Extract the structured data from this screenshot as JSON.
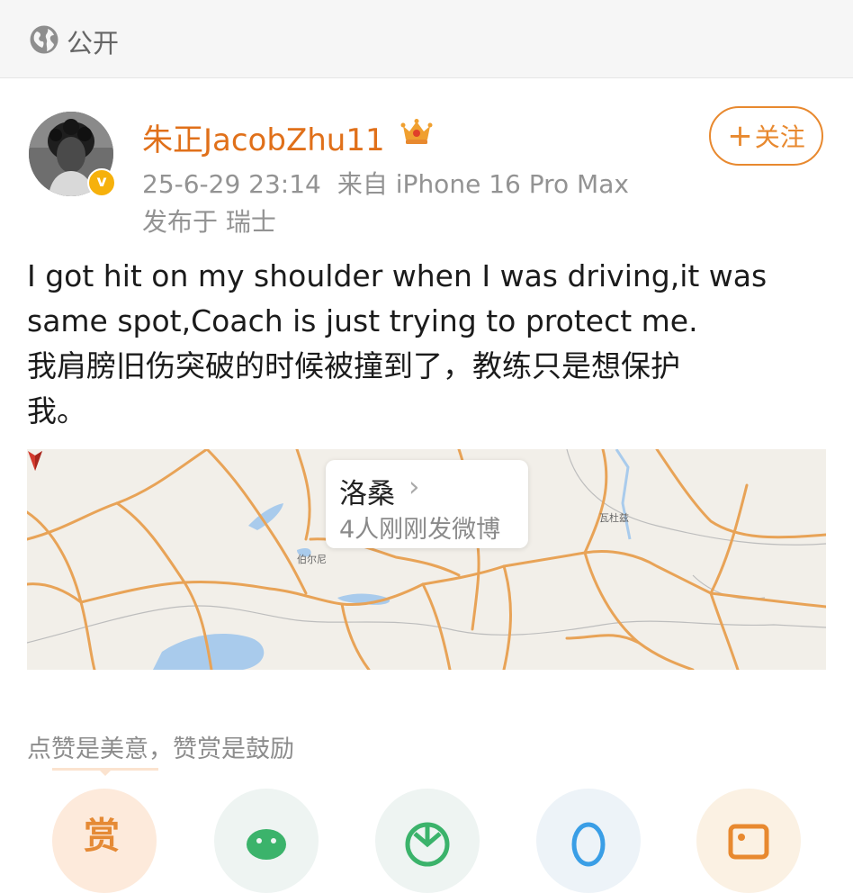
{
  "header": {
    "visibility_icon": "globe-icon",
    "visibility_label": "公开"
  },
  "post": {
    "author": {
      "name": "朱正JacobZhu11",
      "avatar": "avatar",
      "verified_badge_text": "v",
      "verified_icon": "verified-badge-icon",
      "member_icon": "crown-icon"
    },
    "timestamp": "25-6-29 23:14",
    "source": "来自 iPhone 16 Pro Max",
    "location": "发布于 瑞士",
    "follow_button_label": "关注",
    "text_lines": [
      "I got hit on my shoulder when I was driving,it was",
      "same spot,Coach is just trying to protect me.",
      "我肩膀旧伤突破的时候被撞到了，教练只是想保护",
      "我。"
    ]
  },
  "map": {
    "place_name": "洛桑",
    "place_sub": "4人刚刚发微博",
    "chevron_icon": "chevron-right-icon",
    "pin_icon": "location-pin-icon",
    "small_labels": [
      "伯尔尼",
      "瓦杜兹"
    ]
  },
  "reward": {
    "tip_text": "点赞是美意，赞赏是鼓励",
    "action_icons": [
      "reward-icon",
      "wechat-icon",
      "moments-icon",
      "qq-icon",
      "photo-icon"
    ],
    "reward_label": "赏"
  },
  "colors": {
    "accent": "#e8892f",
    "username": "#e0701a",
    "verified": "#f6b10c",
    "meta_gray": "#939393",
    "map_road": "#e8a357",
    "map_water": "#a9cbec"
  }
}
